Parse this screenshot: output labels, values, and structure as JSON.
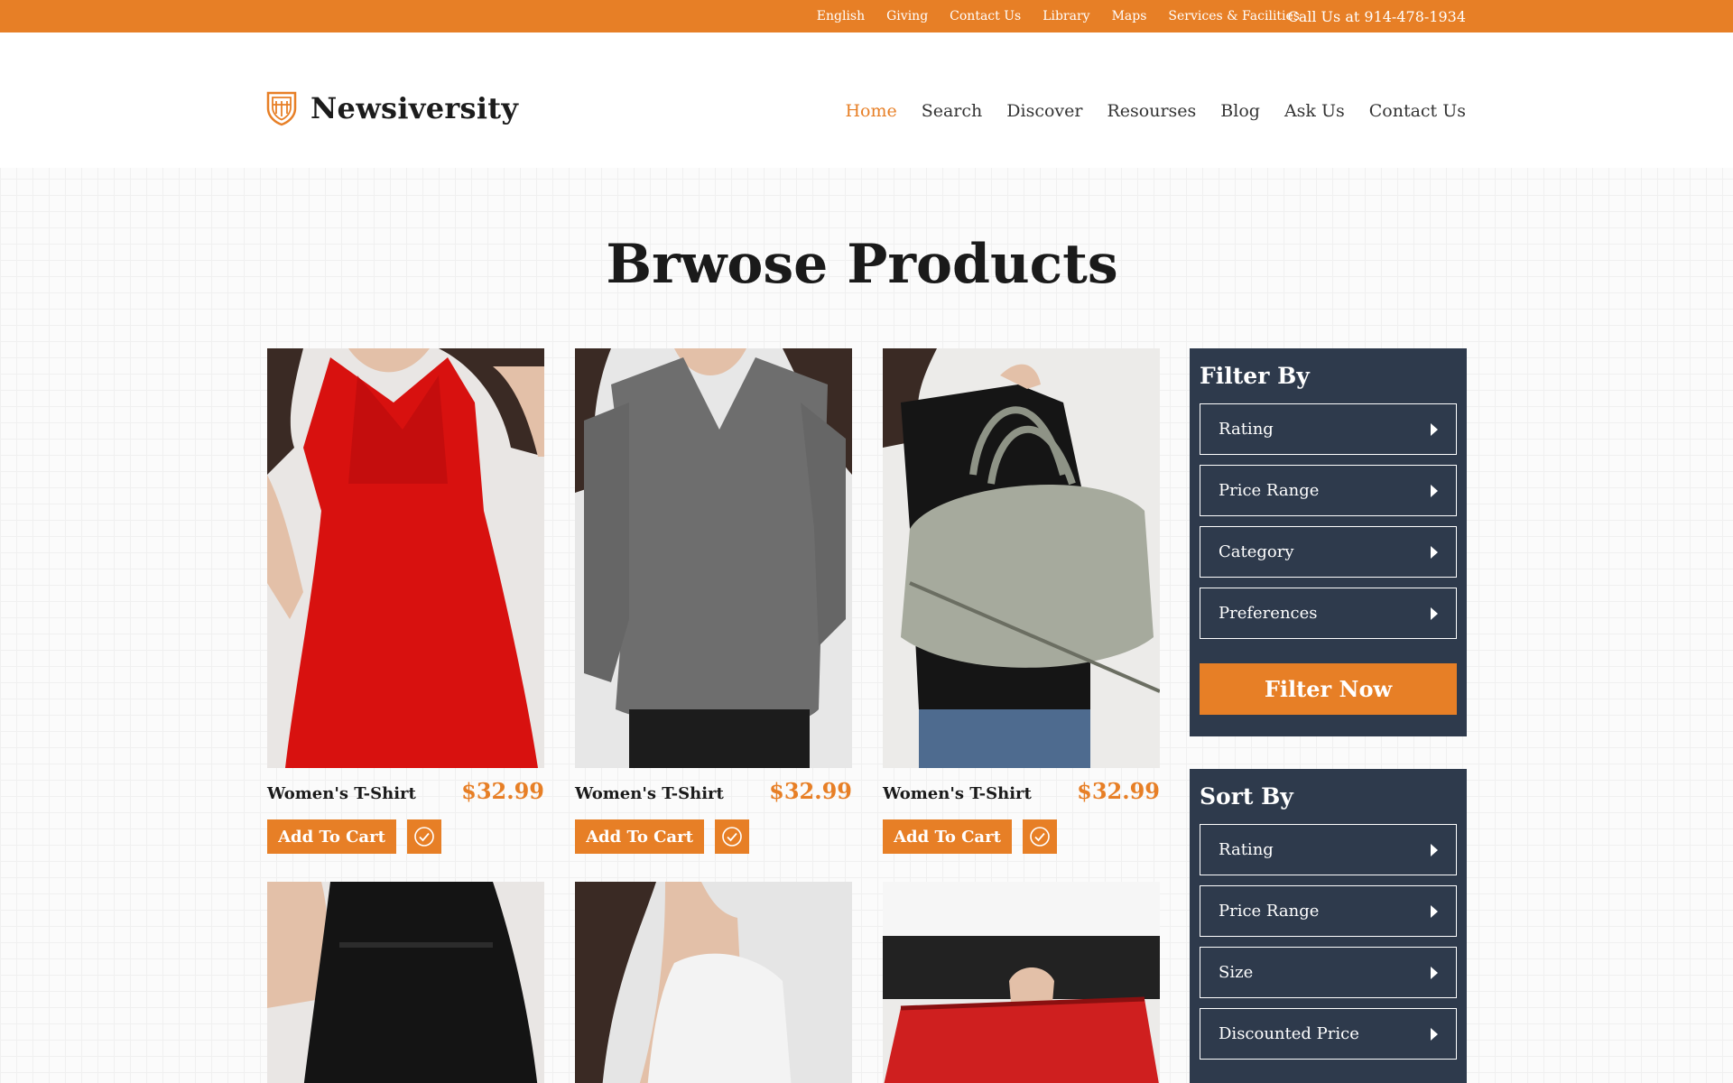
{
  "topbar": {
    "links": [
      "English",
      "Giving",
      "Contact Us",
      "Library",
      "Maps",
      "Services & Facilities"
    ],
    "call": "Call Us at 914-478-1934"
  },
  "header": {
    "logo_text": "Newsiversity",
    "nav": [
      "Home",
      "Search",
      "Discover",
      "Resourses",
      "Blog",
      "Ask Us",
      "Contact Us"
    ],
    "active_nav": "Home"
  },
  "page_title": "Brwose Products",
  "products": [
    {
      "name": "Women's T-Shirt",
      "price": "$32.99",
      "cart_label": "Add To Cart",
      "image": "red-dress-photo"
    },
    {
      "name": "Women's T-Shirt",
      "price": "$32.99",
      "cart_label": "Add To Cart",
      "image": "grey-top-photo"
    },
    {
      "name": "Women's T-Shirt",
      "price": "$32.99",
      "cart_label": "Add To Cart",
      "image": "canvas-bag-photo"
    },
    {
      "image": "black-dress-photo"
    },
    {
      "image": "white-top-photo"
    },
    {
      "image": "red-bag-photo"
    }
  ],
  "filter": {
    "title": "Filter By",
    "items": [
      "Rating",
      "Price Range",
      "Category",
      "Preferences"
    ],
    "button": "Filter Now"
  },
  "sort": {
    "title": "Sort By",
    "items": [
      "Rating",
      "Price Range",
      "Size",
      "Discounted Price"
    ]
  },
  "colors": {
    "accent": "#e77f26",
    "panel": "#2e3a4c",
    "text": "#1a1a1a"
  }
}
